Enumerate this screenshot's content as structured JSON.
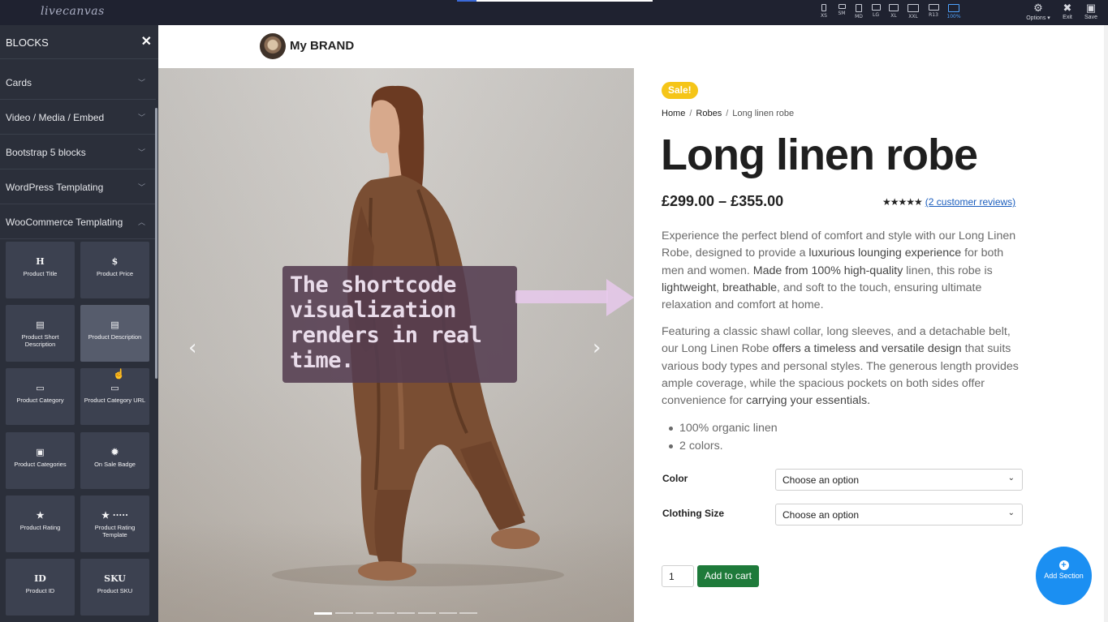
{
  "app": {
    "logo": "livecanvas",
    "viewports": [
      {
        "label": "XS",
        "icon": "phone-icon"
      },
      {
        "label": "SM",
        "icon": "phone-landscape-icon"
      },
      {
        "label": "MD",
        "icon": "tablet-icon"
      },
      {
        "label": "LG",
        "icon": "tablet-landscape-icon"
      },
      {
        "label": "XL",
        "icon": "monitor-icon"
      },
      {
        "label": "XXL",
        "icon": "monitor-icon"
      },
      {
        "label": "R13",
        "icon": "laptop-icon"
      },
      {
        "label": "100%",
        "icon": "monitor-icon",
        "active": true
      }
    ],
    "actions": [
      {
        "label": "Options ▾",
        "icon": "gear-icon"
      },
      {
        "label": "Exit",
        "icon": "close-circle-icon"
      },
      {
        "label": "Save",
        "icon": "floppy-icon"
      }
    ],
    "progress": 0.1,
    "accent_color": "#4fa3ff"
  },
  "sidebar": {
    "title": "BLOCKS",
    "close_icon": "close-icon",
    "sections": [
      {
        "label": "Cards",
        "expanded": false
      },
      {
        "label": "Video / Media / Embed",
        "expanded": false
      },
      {
        "label": "Bootstrap 5 blocks",
        "expanded": false
      },
      {
        "label": "WordPress Templating",
        "expanded": false
      },
      {
        "label": "WooCommerce Templating",
        "expanded": true
      }
    ],
    "blocks": [
      {
        "label": "Product Title",
        "glyph": "H",
        "icon": "heading-icon"
      },
      {
        "label": "Product Price",
        "glyph": "$",
        "icon": "dollar-icon"
      },
      {
        "label": "Product Short Description",
        "glyph": "▤",
        "icon": "document-icon"
      },
      {
        "label": "Product Description",
        "glyph": "▤",
        "icon": "document-filled-icon",
        "hover": true
      },
      {
        "label": "Product Category",
        "glyph": "▭",
        "icon": "folder-icon"
      },
      {
        "label": "Product Category URL",
        "glyph": "▭",
        "icon": "folder-link-icon"
      },
      {
        "label": "Product Categories",
        "glyph": "▣",
        "icon": "folders-icon"
      },
      {
        "label": "On Sale Badge",
        "glyph": "✹",
        "icon": "badge-icon"
      },
      {
        "label": "Product Rating",
        "glyph": "★",
        "icon": "star-icon"
      },
      {
        "label": "Product Rating Template",
        "glyph": "★ ·····",
        "icon": "star-template-icon"
      },
      {
        "label": "Product ID",
        "glyph": "ID",
        "icon": "id-icon"
      },
      {
        "label": "Product SKU",
        "glyph": "SKU",
        "icon": "sku-icon"
      }
    ]
  },
  "site": {
    "brand": "My BRAND"
  },
  "gallery": {
    "overlay_text": "The shortcode visualization renders in real time.",
    "slide_count": 8,
    "active_slide": 0,
    "overlay_color": "#543c50",
    "arrow_color": "#e7c9ec"
  },
  "product": {
    "badge": "Sale!",
    "badge_color": "#f5c518",
    "breadcrumb": [
      "Home",
      "Robes",
      "Long linen robe"
    ],
    "title": "Long linen robe",
    "price": "£299.00 – £355.00",
    "stars": "★★★★★",
    "reviews_link": "(2 customer reviews)",
    "description_1": [
      {
        "t": "Experience the perfect blend of comfort and style with our Long Linen Robe, designed to provide a ",
        "b": false
      },
      {
        "t": "luxurious lounging experience",
        "b": true
      },
      {
        "t": " for both men and women. ",
        "b": false
      },
      {
        "t": "Made from 100% high-quality",
        "b": true
      },
      {
        "t": " linen, this robe is ",
        "b": false
      },
      {
        "t": "lightweight",
        "b": true
      },
      {
        "t": ", ",
        "b": false
      },
      {
        "t": "breathable",
        "b": true
      },
      {
        "t": ", and soft to the touch, ensuring ultimate relaxation and comfort at home.",
        "b": false
      }
    ],
    "description_2": [
      {
        "t": "Featuring a classic shawl collar, long sleeves, and a detachable belt, our Long Linen Robe ",
        "b": false
      },
      {
        "t": "offers a timeless and versatile design",
        "b": true
      },
      {
        "t": " that suits various body types and personal styles. The generous length provides ample coverage, while the spacious pockets on both sides offer convenience for ",
        "b": false
      },
      {
        "t": "carrying your essentials.",
        "b": true
      }
    ],
    "bullets": [
      "100% organic linen",
      "2 colors."
    ],
    "variations": [
      {
        "label": "Color",
        "value": "Choose an option"
      },
      {
        "label": "Clothing Size",
        "value": "Choose an option"
      }
    ],
    "quantity": "1",
    "add_to_cart": "Add to cart",
    "cart_color": "#1e7a3a"
  },
  "fab": {
    "label": "Add Section",
    "icon": "plus-circle-icon",
    "color": "#1b8ff2"
  }
}
